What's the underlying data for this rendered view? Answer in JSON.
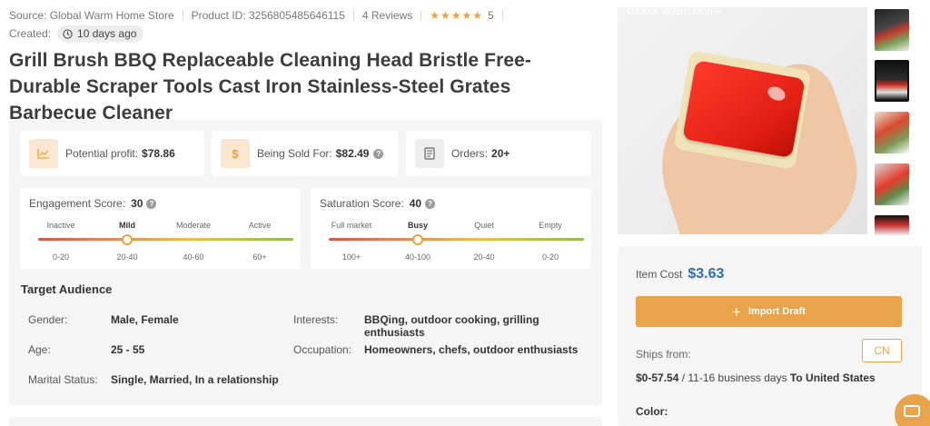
{
  "meta": {
    "source": "Source: Global Warm Home Store",
    "product_id": "Product ID: 3256805485646115",
    "reviews": "4 Reviews",
    "rating": 5,
    "rating_text": "5",
    "created_label": "Created:",
    "created_value": "10 days ago"
  },
  "title": "Grill Brush BBQ Replaceable Cleaning Head Bristle Free-Durable Scraper Tools Cast Iron Stainless-Steel Grates Barbecue Cleaner",
  "stats": {
    "profit_label": "Potential profit:",
    "profit_value": "$78.86",
    "sold_label": "Being Sold For:",
    "sold_value": "$82.49",
    "orders_label": "Orders:",
    "orders_value": "20+"
  },
  "engagement": {
    "label": "Engagement Score:",
    "value": "30",
    "levels": [
      "Inactive",
      "Mild",
      "Moderate",
      "Active"
    ],
    "ranges": [
      "0-20",
      "20-40",
      "40-60",
      "60+"
    ],
    "active_index": 1
  },
  "saturation": {
    "label": "Saturation Score:",
    "value": "40",
    "levels": [
      "Full market",
      "Busy",
      "Quiet",
      "Empty"
    ],
    "ranges": [
      "100+",
      "40-100",
      "20-40",
      "0-20"
    ],
    "active_index": 1
  },
  "audience": {
    "title": "Target Audience",
    "gender_label": "Gender:",
    "gender_value": "Male, Female",
    "age_label": "Age:",
    "age_value": "25 - 55",
    "marital_label": "Marital Status:",
    "marital_value": "Single, Married, In a relationship",
    "interests_label": "Interests:",
    "interests_value": "BBQing, outdoor cooking, grilling enthusiasts",
    "occupation_label": "Occupation:",
    "occupation_value": "Homeowners, chefs, outdoor enthusiasts"
  },
  "image": {
    "watermark": "Global Warm Home",
    "thumbnail_count": 5
  },
  "purchase": {
    "item_cost_label": "Item Cost",
    "item_cost_value": "$3.63",
    "import_label": "Import Draft",
    "ships_from_label": "Ships from:",
    "ships_from_value": "CN",
    "ship_cost": "$0-57.54",
    "ship_days": "/ 11-16 business days",
    "ship_to": "To United States",
    "color_label": "Color:"
  },
  "colors": {
    "accent": "#e9a34a",
    "price_blue": "#2b6fb3",
    "panel_bg": "#f5f5f5"
  }
}
